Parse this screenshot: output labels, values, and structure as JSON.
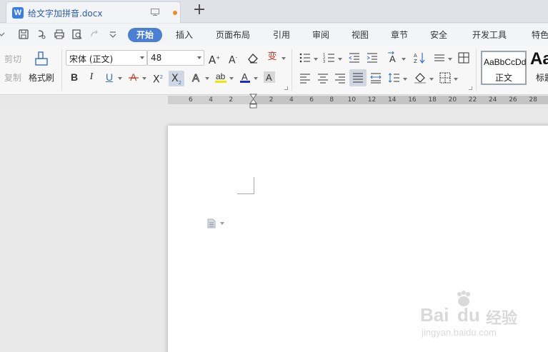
{
  "tab": {
    "title": "给文字加拼音.docx",
    "logo": "W",
    "new_tab_symbol": "+"
  },
  "menu": {
    "active": "开始",
    "items": [
      "插入",
      "页面布局",
      "引用",
      "审阅",
      "视图",
      "章节",
      "安全",
      "开发工具",
      "特色"
    ]
  },
  "ribbon": {
    "cut_label": "剪切",
    "copy_label": "复制",
    "format_painter_label": "格式刷",
    "font_name": "宋体 (正文)",
    "font_size": "48",
    "phonetic_glyph": "变",
    "bold": "B",
    "italic": "I",
    "underline": "U",
    "style_normal_sample": "AaBbCcDd",
    "style_normal_name": "正文",
    "style_heading_sample": "Aa",
    "style_heading_name": "标题"
  },
  "ruler": {
    "ticks": [
      "6",
      "4",
      "2",
      "2",
      "4",
      "6",
      "8",
      "10",
      "12",
      "14",
      "16",
      "18",
      "20",
      "22",
      "24",
      "26",
      "28"
    ]
  },
  "watermark": {
    "brand": "Bai",
    "brand2": "经验",
    "url": "jingyan.baidu.com"
  },
  "colors": {
    "accent": "#4a7fd4",
    "logo": "#3a7ee4",
    "unsaved_dot": "#f28b1c"
  }
}
